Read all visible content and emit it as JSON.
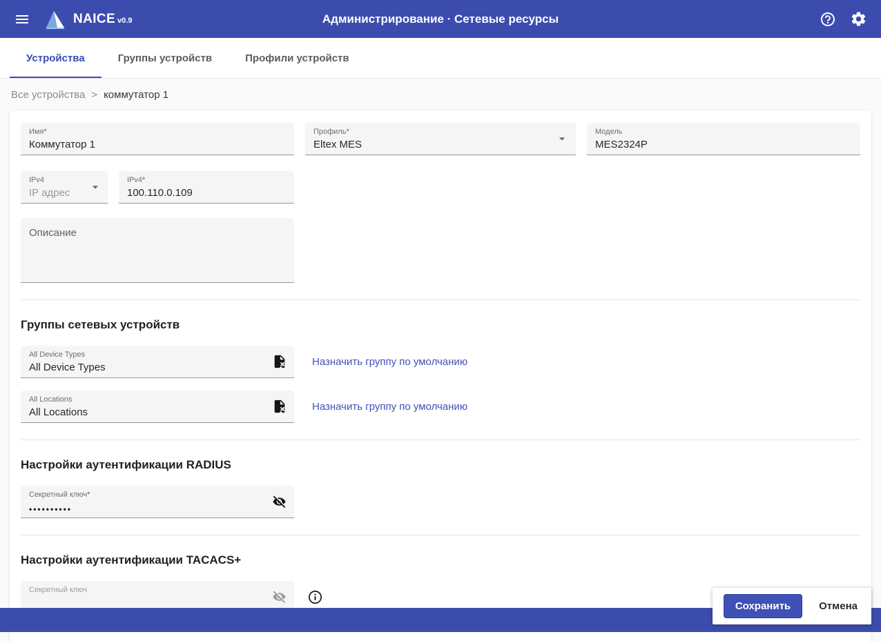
{
  "colors": {
    "appbar": "#3c4cae",
    "accent": "#3f51b5",
    "active_tab": "#3a4bb0",
    "link": "#3f51b5",
    "required_asterisk": "#d32f2f",
    "field_background": "#f5f5f5"
  },
  "app_bar": {
    "brand": "NAICE",
    "version": "v0.9",
    "title": "Администрирование · Сетевые ресурсы"
  },
  "icons": {
    "menu": "hamburger-menu",
    "logo": "naice-sail-logo",
    "help": "question-circle",
    "settings": "gear",
    "profile_dropdown": "chevron-down",
    "ip_type_dropdown": "chevron-down",
    "group_default": "file-remove",
    "radius_visibility": "eye-off",
    "tacacs_visibility": "eye-off",
    "tacacs_info": "info-circle"
  },
  "tabs": [
    {
      "label": "Устройства",
      "active": true
    },
    {
      "label": "Группы устройств",
      "active": false
    },
    {
      "label": "Профили устройств",
      "active": false
    }
  ],
  "breadcrumb": {
    "root": "Все устройства",
    "separator": ">",
    "current": "коммутатор 1"
  },
  "form": {
    "name": {
      "label": "Имя",
      "req": "*",
      "value": "Коммутатор 1"
    },
    "profile": {
      "label": "Профиль",
      "req": "*",
      "value": "Eltex MES"
    },
    "model": {
      "label": "Модель",
      "value": "MES2324P"
    },
    "ip_type": {
      "label": "IPv4",
      "value": "IP адрес"
    },
    "ipv4": {
      "label": "IPv4",
      "req": "*",
      "value": "100.110.0.109"
    },
    "description": {
      "placeholder": "Описание",
      "value": ""
    }
  },
  "groups": {
    "title": "Группы сетевых устройств",
    "items": [
      {
        "label": "All Device Types",
        "value": "All Device Types",
        "action": "Назначить группу по умолчанию"
      },
      {
        "label": "All Locations",
        "value": "All Locations",
        "action": "Назначить группу по умолчанию"
      }
    ]
  },
  "radius": {
    "title": "Настройки аутентификации RADIUS",
    "secret": {
      "label": "Секретный ключ",
      "req": "*",
      "value": "••••••••••"
    }
  },
  "tacacs": {
    "title": "Настройки аутентификации TACACS+",
    "secret": {
      "label": "Секретный ключ",
      "value": ""
    }
  },
  "actions": {
    "save": "Сохранить",
    "cancel": "Отмена"
  }
}
